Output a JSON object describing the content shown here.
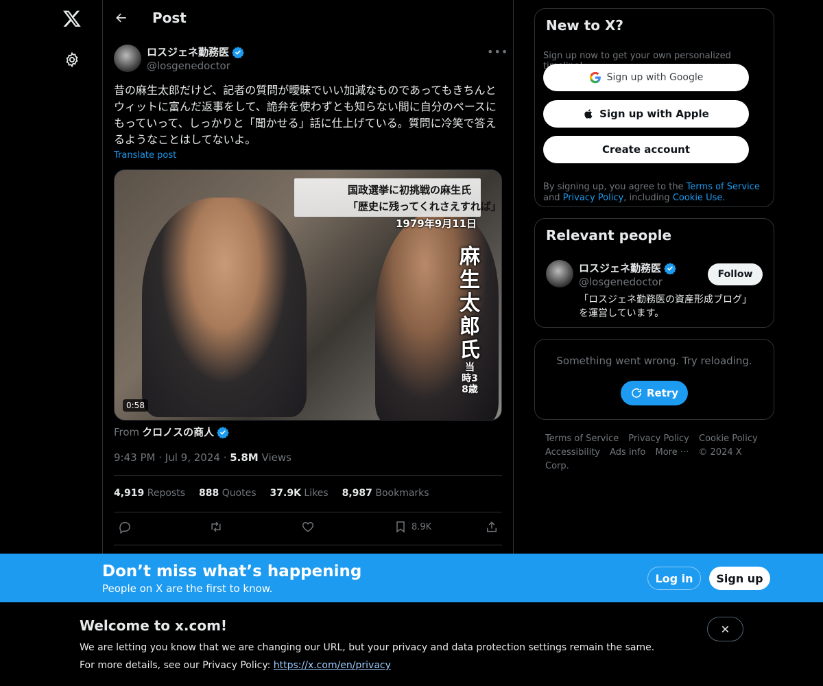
{
  "header": {
    "title": "Post"
  },
  "tweet": {
    "author_name": "ロスジェネ勤務医",
    "author_handle": "@losgenedoctor",
    "text": "昔の麻生太郎だけど、記者の質問が曖昧でいい加減なものであってもきちんとウィットに富んだ返事をして、詭弁を使わずとも知らない間に自分のペースにもっていって、しっかりと「聞かせる」話に仕上げている。質問に冷笑で答えるようなことはしてないよ。",
    "translate": "Translate post",
    "media": {
      "caption_line1": "国政選挙に初挑戦の麻生氏",
      "caption_line2": "「歴史に残ってくれさえすれば」",
      "caption_date": "1979年9月11日",
      "vertical_name": "麻生太郎氏",
      "vertical_age": "当時38歳",
      "duration": "0:58"
    },
    "from_label": "From",
    "from_source": "クロノスの商人",
    "time": "9:43 PM",
    "date": "Jul 9, 2024",
    "views_count": "5.8M",
    "views_label": "Views",
    "reposts_count": "4,919",
    "reposts_label": "Reposts",
    "quotes_count": "888",
    "quotes_label": "Quotes",
    "likes_count": "37.9K",
    "likes_label": "Likes",
    "bookmarks_count": "8,987",
    "bookmarks_label": "Bookmarks",
    "bookmark_action_count": "8.9K"
  },
  "sidebar": {
    "new_to_x": {
      "title": "New to X?",
      "subtitle": "Sign up now to get your own personalized timeline!",
      "google_button": "Sign up with Google",
      "apple_button": "Sign up with Apple",
      "create_button": "Create account",
      "legal_prefix": "By signing up, you agree to the ",
      "terms_link": "Terms of Service",
      "legal_and": " and ",
      "privacy_link": "Privacy Policy",
      "legal_including": ", including ",
      "cookie_link": "Cookie Use."
    },
    "relevant": {
      "title": "Relevant people",
      "name": "ロスジェネ勤務医",
      "handle": "@losgenedoctor",
      "follow": "Follow",
      "bio": "「ロスジェネ勤務医の資産形成ブログ」を運営しています。"
    },
    "error": {
      "message": "Something went wrong. Try reloading.",
      "retry": "Retry"
    },
    "footer": {
      "links": [
        "Terms of Service",
        "Privacy Policy",
        "Cookie Policy",
        "Accessibility",
        "Ads info",
        "More ···",
        "© 2024 X Corp."
      ]
    }
  },
  "banner": {
    "title": "Don’t miss what’s happening",
    "subtitle": "People on X are the first to know.",
    "login": "Log in",
    "signup": "Sign up"
  },
  "notice": {
    "title": "Welcome to x.com!",
    "line1": "We are letting you know that we are changing our URL, but your privacy and data protection settings remain the same.",
    "line2_prefix": "For more details, see our Privacy Policy: ",
    "line2_link": "https://x.com/en/privacy",
    "close": "✕"
  },
  "colors": {
    "accent": "#1d9bf0",
    "background": "#000000",
    "border": "#2f3336",
    "muted": "#71767b"
  },
  "icons": [
    "x-logo-icon",
    "gear-icon",
    "back-arrow-icon",
    "verified-badge-icon",
    "more-icon",
    "reply-icon",
    "repost-icon",
    "like-icon",
    "bookmark-icon",
    "share-icon",
    "google-icon",
    "apple-icon",
    "retry-icon",
    "close-icon"
  ]
}
